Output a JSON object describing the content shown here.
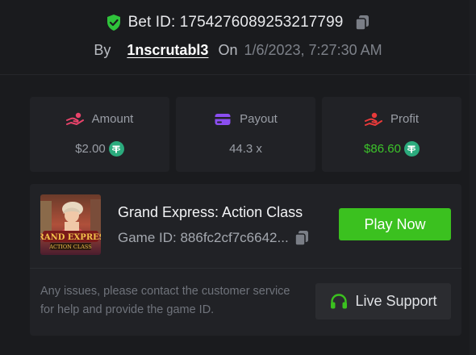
{
  "header": {
    "bet_id_label": "Bet ID: 1754276089253217799",
    "by_label": "By",
    "username": "1nscrutabl3",
    "on_label": "On",
    "datetime": "1/6/2023, 7:27:30 AM"
  },
  "stats": [
    {
      "label": "Amount",
      "value": "$2.00",
      "icon": "amount-hand-icon",
      "currency_icon": "tether-icon"
    },
    {
      "label": "Payout",
      "value": "44.3 x",
      "icon": "card-icon"
    },
    {
      "label": "Profit",
      "value": "$86.60",
      "icon": "profit-hand-icon",
      "currency_icon": "tether-icon"
    }
  ],
  "game": {
    "title": "Grand Express: Action Class",
    "game_id": "Game ID: 886fc2cf7c6642...",
    "thumbnail_alt": "Grand Express Action Class",
    "play_label": "Play Now"
  },
  "support": {
    "message": "Any issues, please contact the customer service for help and provide the game ID.",
    "button_label": "Live Support"
  },
  "colors": {
    "background": "#1a1b1e",
    "card": "#212226",
    "accent_green": "#3bc11f",
    "profit_green": "#3cc32a",
    "tether": "#2bab7d",
    "amount_icon": "#e8436a",
    "payout_icon": "#8b4ef0",
    "profit_icon": "#e83a3a"
  }
}
